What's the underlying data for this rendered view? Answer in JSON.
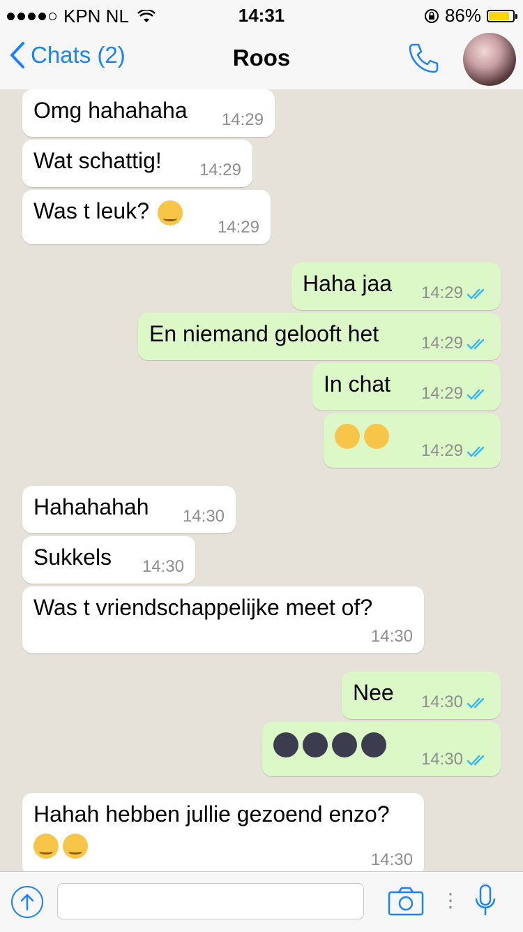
{
  "status_bar": {
    "carrier": "KPN NL",
    "time": "14:31",
    "battery": "86%",
    "battery_level": 0.86
  },
  "header": {
    "back_label": "Chats (2)",
    "contact_name": "Roos"
  },
  "messages": [
    {
      "side": "in",
      "text": "Omg hahahaha",
      "time": "14:29"
    },
    {
      "side": "in",
      "text": "Wat schattig!",
      "time": "14:29"
    },
    {
      "side": "in",
      "text": "Was t leuk?",
      "emoji": [
        "smirk"
      ],
      "time": "14:29"
    },
    {
      "side": "out",
      "text": "Haha jaa",
      "time": "14:29",
      "read": true
    },
    {
      "side": "out",
      "text": "En niemand gelooft het",
      "time": "14:29",
      "read": true
    },
    {
      "side": "out",
      "text": "In chat",
      "time": "14:29",
      "read": true
    },
    {
      "side": "out",
      "emoji": [
        "laughing-tears",
        "crying"
      ],
      "time": "14:29",
      "read": true
    },
    {
      "side": "in",
      "text": "Hahahahah",
      "time": "14:30"
    },
    {
      "side": "in",
      "text": "Sukkels",
      "time": "14:30"
    },
    {
      "side": "in",
      "text": "Was t vriendschappelijke meet of?",
      "time": "14:30"
    },
    {
      "side": "out",
      "text": "Nee",
      "time": "14:30",
      "read": true
    },
    {
      "side": "out",
      "emoji": [
        "new-moon-face",
        "new-moon-face",
        "new-moon-face",
        "new-moon-face"
      ],
      "time": "14:30",
      "read": true
    },
    {
      "side": "in",
      "text": "Hahah hebben jullie gezoend enzo?",
      "emoji": [
        "smirk",
        "smirk"
      ],
      "time": "14:30"
    }
  ],
  "input_bar": {
    "placeholder": "",
    "icons": [
      "upload-icon",
      "camera-icon",
      "more-icon",
      "microphone-icon"
    ]
  },
  "colors": {
    "accent": "#1a84ff",
    "incoming_bubble": "#ffffff",
    "outgoing_bubble": "#dcf8c6",
    "read_tick": "#34b7f1",
    "chat_background": "#e6e1d9"
  }
}
